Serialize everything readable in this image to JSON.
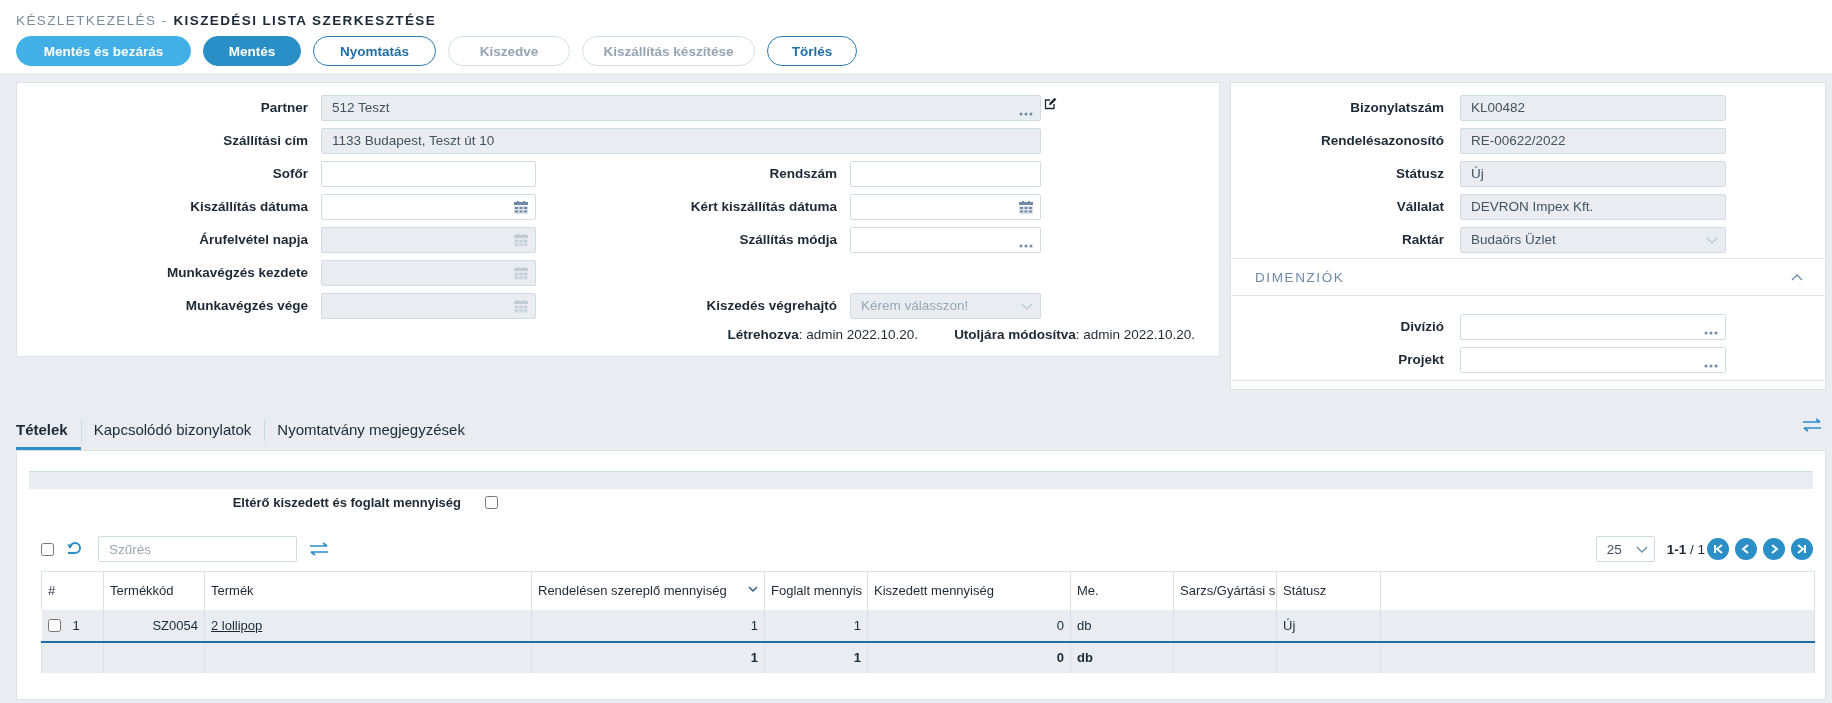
{
  "header": {
    "breadcrumb": "KÉSZLETKEZELÉS -",
    "title": "KISZEDÉSI LISTA SZERKESZTÉSE"
  },
  "toolbar": [
    {
      "label": "Mentés és bezárás",
      "kind": "light",
      "disabled": false
    },
    {
      "label": "Mentés",
      "kind": "primary",
      "disabled": false
    },
    {
      "label": "Nyomtatás",
      "kind": "outline",
      "disabled": false
    },
    {
      "label": "Kiszedve",
      "kind": "outline",
      "disabled": true
    },
    {
      "label": "Kiszállítás készítése",
      "kind": "outline",
      "disabled": true
    },
    {
      "label": "Törlés",
      "kind": "outline",
      "disabled": false
    }
  ],
  "form": {
    "rows": [
      {
        "kind": "wide",
        "editable": true,
        "fields": [
          {
            "label": "Partner",
            "value": "512 Teszt",
            "kind": "lookup",
            "disabled": true
          }
        ]
      },
      {
        "kind": "wide",
        "fields": [
          {
            "label": "Szállítási cím",
            "value": "1133 Budapest, Teszt út 10",
            "kind": "text",
            "disabled": true
          }
        ]
      },
      {
        "kind": "pair",
        "fields": [
          {
            "label": "Sofőr",
            "kind": "text",
            "disabled": false
          },
          {
            "label": "Rendszám",
            "kind": "text",
            "disabled": false
          }
        ]
      },
      {
        "kind": "pair",
        "fields": [
          {
            "label": "Kiszállítás dátuma",
            "kind": "date",
            "disabled": false
          },
          {
            "label": "Kért kiszállítás dátuma",
            "kind": "date",
            "disabled": false
          }
        ]
      },
      {
        "kind": "pair",
        "fields": [
          {
            "label": "Árufelvétel napja",
            "kind": "date",
            "disabled": true
          },
          {
            "label": "Szállítás módja",
            "kind": "lookup",
            "disabled": false
          }
        ]
      },
      {
        "kind": "pair",
        "fields": [
          {
            "label": "Munkavégzés kezdete",
            "kind": "date",
            "disabled": true
          }
        ]
      },
      {
        "kind": "pair",
        "fields": [
          {
            "label": "Munkavégzés vége",
            "kind": "date",
            "disabled": true
          },
          {
            "label": "Kiszedés végrehajtó",
            "placeholder": "Kérem válasszon!",
            "kind": "select",
            "disabled": true
          }
        ]
      }
    ],
    "meta": [
      "**Létrehozva**: admin 2022.10.20.",
      "**Utoljára módosítva**: admin 2022.10.20."
    ]
  },
  "details": {
    "fields": [
      {
        "label": "Bizonylatszám",
        "value": "KL00482",
        "kind": "text",
        "disabled": true
      },
      {
        "label": "Rendelésazonosító",
        "value": "RE-00622/2022",
        "kind": "text",
        "disabled": true
      },
      {
        "label": "Státusz",
        "value": "Új",
        "kind": "text",
        "disabled": true
      },
      {
        "label": "Vállalat",
        "value": "DEVRON Impex Kft.",
        "kind": "text",
        "disabled": true
      },
      {
        "label": "Raktár",
        "value": "Budaörs Üzlet",
        "kind": "select",
        "disabled": true
      }
    ],
    "section": {
      "title": "DIMENZIÓK",
      "expanded": true,
      "fields": [
        {
          "label": "Divízió",
          "kind": "lookup",
          "disabled": false
        },
        {
          "label": "Projekt",
          "kind": "lookup",
          "disabled": false
        }
      ]
    }
  },
  "tabs": [
    {
      "label": "Tételek",
      "selected": true
    },
    {
      "label": "Kapcsolódó bizonylatok",
      "selected": false
    },
    {
      "label": "Nyomtatvány megjegyzések",
      "selected": false
    }
  ],
  "filter": {
    "label": "Eltérő kiszedett és foglalt mennyiség",
    "checked": false
  },
  "grid": {
    "select_all": false,
    "search": {
      "placeholder": "Szűrés"
    },
    "page_size": "25",
    "page_info": "**1-1** / 1",
    "columns": [
      {
        "label": "#",
        "kind": "index"
      },
      {
        "label": "Termékkód",
        "kind": "number"
      },
      {
        "label": "Termék",
        "kind": "link"
      },
      {
        "label": "Rendelésen szereplő mennyiség",
        "kind": "number",
        "sorted": true,
        "total": "1"
      },
      {
        "label": "Foglalt mennyis",
        "kind": "number",
        "total": "1"
      },
      {
        "label": "Kiszedett mennyiség",
        "kind": "number",
        "total": "0"
      },
      {
        "label": "Me.",
        "kind": "text",
        "total": "db"
      },
      {
        "label": "Sarzs/Gyártási s",
        "kind": "text"
      },
      {
        "label": "Státusz",
        "kind": "text"
      }
    ],
    "rows": [
      {
        "selected": false,
        "cells": [
          "1",
          "SZ0054",
          "2 lollipop",
          "1",
          "1",
          "0",
          "db",
          null,
          "Új"
        ]
      }
    ]
  }
}
